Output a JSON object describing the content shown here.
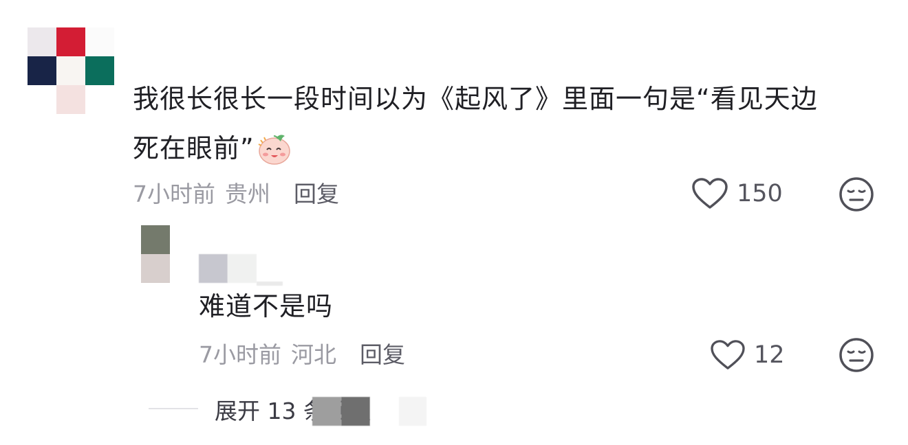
{
  "comments": [
    {
      "text_line1": "我很长很长一段时间以为《起风了》里面一句是“看见天边",
      "text_line2": "死在眼前”",
      "emoji": "smiling-blush-emoji",
      "time": "7小时前",
      "location": "贵州",
      "reply_label": "回复",
      "likes": "150",
      "avatar_colors": [
        "#ece8ec",
        "#d31d34",
        "#f7f7f7",
        "#182447",
        "#f8f5f2",
        "#0b6e5c",
        "#f4e1e0"
      ]
    },
    {
      "text": "难道不是吗",
      "time": "7小时前",
      "location": "河北",
      "reply_label": "回复",
      "likes": "12",
      "avatar_colors": [
        "#747a6c",
        "#d8cfcd"
      ]
    }
  ],
  "expand": {
    "label": "展开 13 条回复"
  },
  "colors": {
    "text": "#1f1f24",
    "meta": "#9a9aa2",
    "icon": "#505058"
  }
}
